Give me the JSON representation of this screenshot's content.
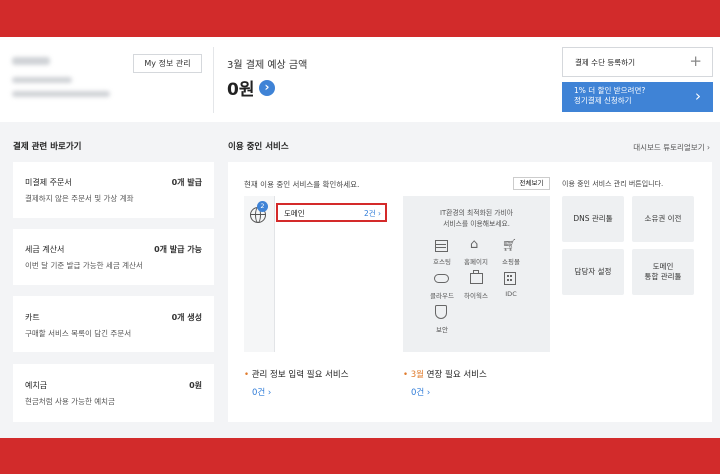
{
  "account": {
    "info_button": "My 정보 관리"
  },
  "billing": {
    "title": "3월 결제 예상 금액",
    "amount": "0원",
    "arrow": "›"
  },
  "payment": {
    "register_label": "결제 수단 등록하기",
    "register_plus": "+",
    "promo_line1": "1% 더 할인 받으려면?",
    "promo_line2": "정기결제 신청하기",
    "promo_arrow": "›",
    "accent_color": "#3f83d6"
  },
  "shortcuts": {
    "heading": "결제 관련 바로가기",
    "items": [
      {
        "title": "미결제 주문서",
        "count": "0개 발급",
        "desc": "결제하지 않은 주문서 및 가상 계좌"
      },
      {
        "title": "세금 계산서",
        "count": "0개 발급 가능",
        "desc": "이번 달 기준 발급 가능한 세금 계산서"
      },
      {
        "title": "카트",
        "count": "0개 생성",
        "desc": "구매할 서비스 목록이 담긴 주문서"
      },
      {
        "title": "예치금",
        "count": "0원",
        "desc": "현금처럼 사용 가능한 예치금"
      }
    ]
  },
  "services": {
    "heading": "이용 중인 서비스",
    "tutorial_link": "대시보드 튜토리얼보기 ›",
    "current_label": "현재 이용 중인 서비스를 확인하세요.",
    "view_all": "전체보기",
    "globe_badge": "2",
    "domain_label": "도메인",
    "domain_count": "2건 ›",
    "promo_line1": "IT환경의 최적화된 가비아",
    "promo_line2": "서비스를 이용해보세요.",
    "items": [
      "호스팅",
      "홈페이지",
      "쇼핑몰",
      "클라우드",
      "하이웍스",
      "IDC",
      "보안"
    ],
    "mgmt_label": "이용 중인 서비스 관리 버튼입니다.",
    "mgmt_buttons": [
      "DNS 관리툴",
      "소유권 이전",
      "담당자 설정",
      "도메인",
      "통합 관리툴"
    ],
    "info_needed_bullet": "•",
    "info_needed_label": "관리 정보 입력 필요 서비스",
    "info_needed_count": "0건 ›",
    "renew_bullet": "•",
    "renew_month": "3월",
    "renew_label": " 연장 필요 서비스",
    "renew_count": "0건 ›"
  }
}
